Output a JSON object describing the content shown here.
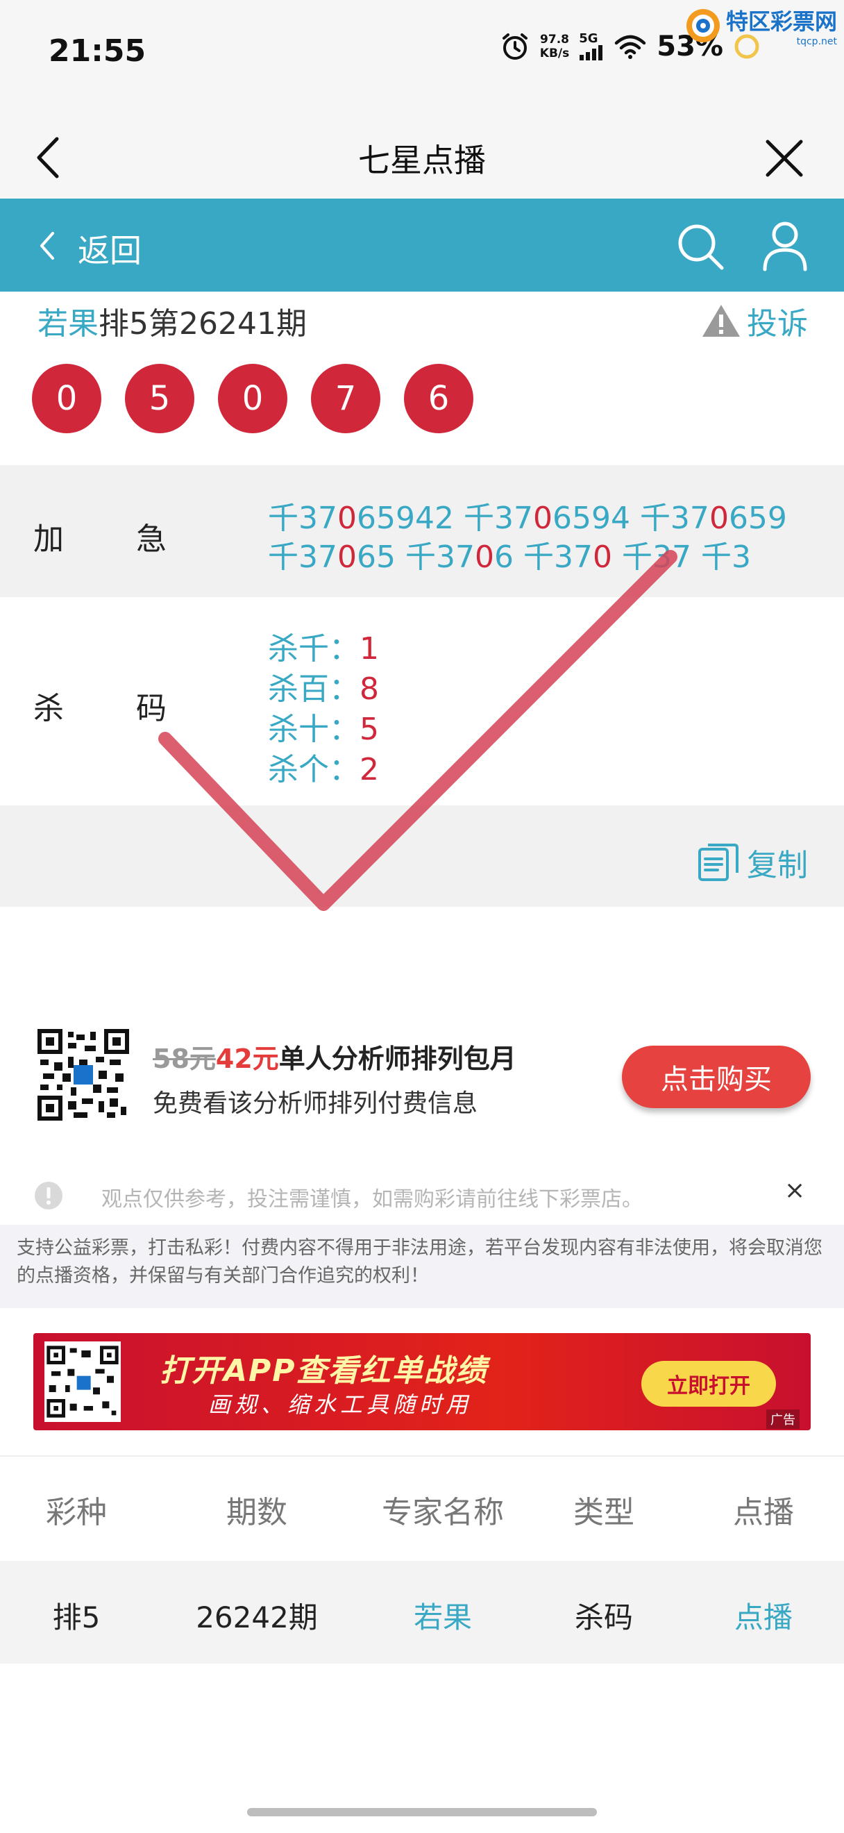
{
  "status_bar": {
    "time": "21:55",
    "net_speed_value": "97.8",
    "net_speed_unit": "KB/s",
    "network": "5G",
    "battery": "53%",
    "icons": [
      "alarm-icon",
      "signal-icon",
      "wifi-icon",
      "battery-ring-icon"
    ]
  },
  "watermark": {
    "title": "特区彩票网",
    "url": "tqcp.net"
  },
  "title_bar": {
    "title": "七星点播",
    "back_icon": "chevron-left-icon",
    "close_icon": "close-icon"
  },
  "nav_bar": {
    "back_label": "返回",
    "search_icon": "search-icon",
    "user_icon": "user-icon",
    "color": "#39a8c4"
  },
  "ticket": {
    "expert": "若果",
    "title_rest": "排5第26241期",
    "complain_label": "投诉",
    "balls": [
      "0",
      "5",
      "0",
      "7",
      "6"
    ],
    "ball_color": "#d1273b"
  },
  "rows": {
    "jiaji": {
      "label_a": "加",
      "label_b": "急",
      "line1": [
        {
          "pre": "千37",
          "hl": "0",
          "post": "65942 "
        },
        {
          "pre": "千37",
          "hl": "0",
          "post": "6594 "
        },
        {
          "pre": "千37",
          "hl": "0",
          "post": "659"
        }
      ],
      "line2": [
        {
          "pre": "千37",
          "hl": "0",
          "post": "65 "
        },
        {
          "pre": "千37",
          "hl": "0",
          "post": "6 "
        },
        {
          "pre": "千37",
          "hl": "0",
          "post": " "
        },
        {
          "pre": "千37",
          "hl": "",
          "post": " "
        },
        {
          "pre": "千3",
          "hl": "",
          "post": ""
        }
      ]
    },
    "shama": {
      "label_a": "杀",
      "label_b": "码",
      "items": [
        {
          "label": "杀千：",
          "value": "1"
        },
        {
          "label": "杀百：",
          "value": "8"
        },
        {
          "label": "杀十：",
          "value": "5"
        },
        {
          "label": "杀个：",
          "value": "2"
        }
      ]
    }
  },
  "copy_label": "复制",
  "promo": {
    "old_price": "58元",
    "new_price": "42元",
    "title": "单人分析师排列包月",
    "subtitle": "免费看该分析师排列付费信息",
    "button": "点击购买"
  },
  "notice": {
    "text": "观点仅供参考，投注需谨慎，如需购彩请前往线下彩票店。",
    "close": "×"
  },
  "disclaimer": "支持公益彩票，打击私彩！付费内容不得用于非法用途，若平台发现内容有非法使用，将会取消您的点播资格，并保留与有关部门合作追究的权利！",
  "banner": {
    "line1": "打开APP查看红单战绩",
    "line2": "画规、缩水工具随时用",
    "button": "立即打开",
    "ad_tag": "广告"
  },
  "table": {
    "headers": [
      "彩种",
      "期数",
      "专家名称",
      "类型",
      "点播"
    ],
    "rows": [
      [
        "排5",
        "26242期",
        "若果",
        "杀码",
        "点播"
      ]
    ]
  }
}
